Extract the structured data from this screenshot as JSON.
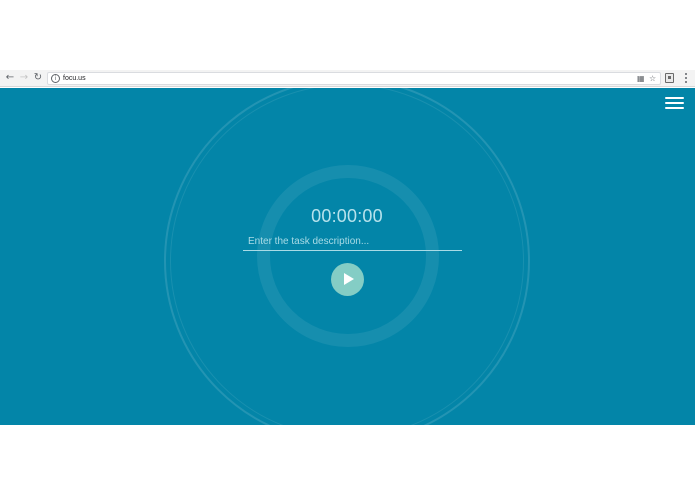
{
  "browser": {
    "url": "focu.us",
    "icons": {
      "back": "back-arrow-icon",
      "forward": "forward-arrow-icon",
      "reload": "reload-icon",
      "site_info": "info-icon",
      "translate": "translate-icon",
      "bookmark": "star-icon",
      "extension": "extension-icon",
      "menu": "more-vertical-icon"
    }
  },
  "app": {
    "timer": "00:00:00",
    "task_placeholder": "Enter the task description...",
    "task_value": "",
    "colors": {
      "background": "#0385a8",
      "play_button": "#84cdc5",
      "timer_text": "#b7e2ec"
    },
    "icons": {
      "menu": "hamburger-menu-icon",
      "play": "play-icon"
    }
  }
}
